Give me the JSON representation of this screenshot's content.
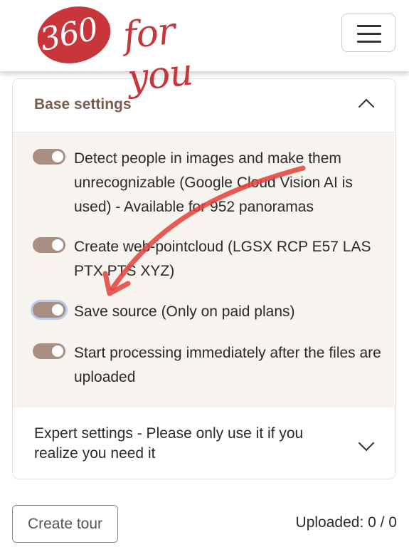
{
  "header": {
    "logo_number": "360",
    "logo_text": "for you",
    "menu_icon": "hamburger-icon"
  },
  "base_settings": {
    "title": "Base settings",
    "options": [
      {
        "label": "Detect people in images and make them unrecognizable (Google Cloud Vision AI is used) - Available for 952 panoramas",
        "enabled": true
      },
      {
        "label": "Create web-pointcloud (LGSX RCP E57 LAS PTX PTS XYZ)",
        "enabled": true
      },
      {
        "label": "Save source (Only on paid plans)",
        "enabled": true
      },
      {
        "label": "Start processing immediately after the files are uploaded",
        "enabled": true
      }
    ]
  },
  "expert_settings": {
    "title": "Expert settings - Please only use it if you realize you need it"
  },
  "footer": {
    "create_tour_label": "Create tour",
    "uploaded_label": "Uploaded:",
    "uploaded_count": "0 / 0"
  },
  "colors": {
    "brand_red": "#c8363c",
    "toggle_brown": "#a98f82",
    "title_brown": "#7a5a4c",
    "annotation_arrow": "#e5403a"
  }
}
